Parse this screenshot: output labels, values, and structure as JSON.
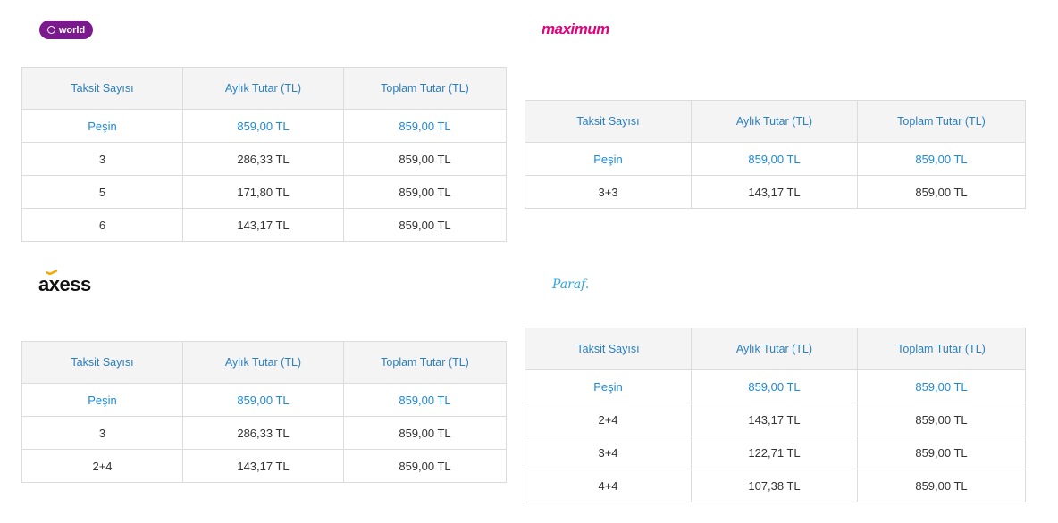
{
  "headers": [
    "Taksit Sayısı",
    "Aylık Tutar (TL)",
    "Toplam Tutar (TL)"
  ],
  "cards": {
    "world": {
      "logo_text": "world",
      "rows": [
        [
          "Peşin",
          "859,00 TL",
          "859,00 TL"
        ],
        [
          "3",
          "286,33 TL",
          "859,00 TL"
        ],
        [
          "5",
          "171,80 TL",
          "859,00 TL"
        ],
        [
          "6",
          "143,17 TL",
          "859,00 TL"
        ]
      ]
    },
    "maximum": {
      "logo_text": "maximum",
      "rows": [
        [
          "Peşin",
          "859,00 TL",
          "859,00 TL"
        ],
        [
          "3+3",
          "143,17 TL",
          "859,00 TL"
        ]
      ]
    },
    "axess": {
      "logo_text": "axess",
      "rows": [
        [
          "Peşin",
          "859,00 TL",
          "859,00 TL"
        ],
        [
          "3",
          "286,33 TL",
          "859,00 TL"
        ],
        [
          "2+4",
          "143,17 TL",
          "859,00 TL"
        ]
      ]
    },
    "paraf": {
      "logo_text": "Paraf.",
      "rows": [
        [
          "Peşin",
          "859,00 TL",
          "859,00 TL"
        ],
        [
          "2+4",
          "143,17 TL",
          "859,00 TL"
        ],
        [
          "3+4",
          "122,71 TL",
          "859,00 TL"
        ],
        [
          "4+4",
          "107,38 TL",
          "859,00 TL"
        ]
      ]
    }
  },
  "colors": {
    "header_text": "#2a7fc1",
    "first_row_text": "#1e8ad6",
    "world_brand": "#7a1a8c",
    "maximum_brand": "#e6007e",
    "axess_accent": "#f5a800",
    "paraf_brand": "#2ca7df"
  }
}
